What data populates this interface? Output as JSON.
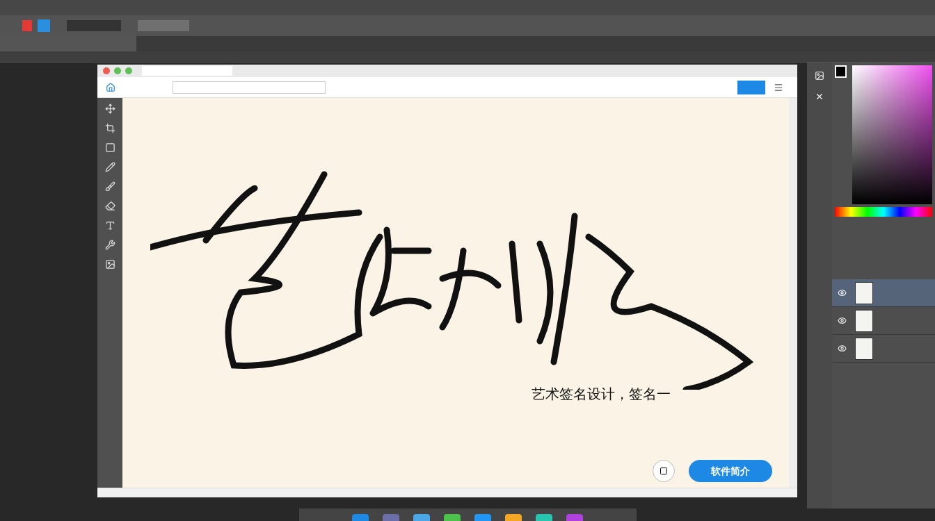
{
  "canvas": {
    "caption": "艺术签名设计，签名一",
    "intro_button": "软件简介"
  },
  "layers": [
    {
      "selected": true
    },
    {
      "selected": false
    },
    {
      "selected": false
    }
  ],
  "dock": [
    {
      "color": "#1e88e5"
    },
    {
      "color": "#6a6fa8"
    },
    {
      "color": "#4aa8e8"
    },
    {
      "color": "#4cc44c"
    },
    {
      "color": "#2196f3"
    },
    {
      "color": "#f5a623"
    },
    {
      "color": "#26c6b0"
    },
    {
      "color": "#b040e0"
    }
  ]
}
